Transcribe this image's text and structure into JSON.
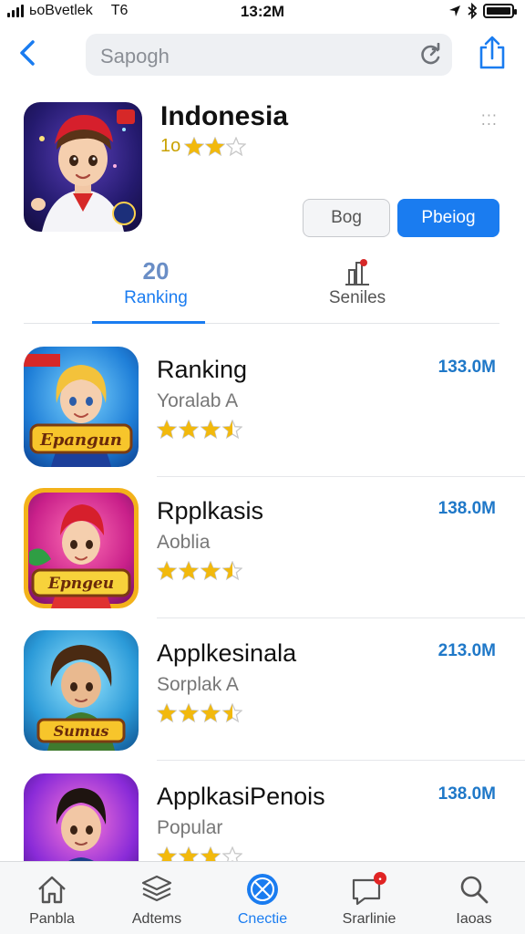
{
  "status_bar": {
    "carrier": "ьоBvetlek",
    "network": "T6",
    "time": "13:2M"
  },
  "search": {
    "placeholder": "Sapogh"
  },
  "header_app": {
    "title": "Indonesia",
    "rating_label": "1o",
    "stars": 3,
    "more_label": "⁚⁚⁚",
    "secondary_button": "Bog",
    "primary_button": "Pbeiog"
  },
  "tabs": [
    {
      "top": "20",
      "label": "Ranking",
      "active": true
    },
    {
      "top": "",
      "label": "Seniles",
      "active": false
    }
  ],
  "apps": [
    {
      "name": "Ranking",
      "subtitle": "Yoralab A",
      "size": "133.0M",
      "rating": 3.5,
      "icon_text": "Epangun"
    },
    {
      "name": "Rpplkasis",
      "subtitle": "Aoblia",
      "size": "138.0M",
      "rating": 3.5,
      "icon_text": "Epngeu"
    },
    {
      "name": "Applkesinala",
      "subtitle": "Sorplak A",
      "size": "213.0M",
      "rating": 3.5,
      "icon_text": "Sumus"
    },
    {
      "name": "ApplkasiPenois",
      "subtitle": "Popular",
      "size": "138.0M",
      "rating": 3,
      "icon_text": ""
    }
  ],
  "bottom_tabs": [
    {
      "label": "Panbla",
      "icon": "home-icon",
      "active": false
    },
    {
      "label": "Adtems",
      "icon": "stack-icon",
      "active": false
    },
    {
      "label": "Cnectie",
      "icon": "globe-icon",
      "active": true
    },
    {
      "label": "Srarlinie",
      "icon": "message-icon",
      "active": false
    },
    {
      "label": "Iaoas",
      "icon": "search-icon",
      "active": false
    }
  ],
  "colors": {
    "accent": "#1a7cf0",
    "star": "#f2b90c",
    "size_text": "#1f78c8"
  }
}
